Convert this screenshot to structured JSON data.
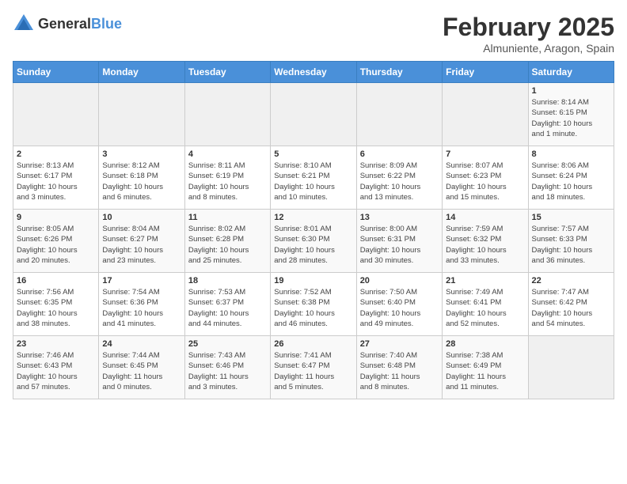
{
  "header": {
    "logo_general": "General",
    "logo_blue": "Blue",
    "title": "February 2025",
    "subtitle": "Almuniente, Aragon, Spain"
  },
  "days_of_week": [
    "Sunday",
    "Monday",
    "Tuesday",
    "Wednesday",
    "Thursday",
    "Friday",
    "Saturday"
  ],
  "weeks": [
    [
      {
        "day": "",
        "info": ""
      },
      {
        "day": "",
        "info": ""
      },
      {
        "day": "",
        "info": ""
      },
      {
        "day": "",
        "info": ""
      },
      {
        "day": "",
        "info": ""
      },
      {
        "day": "",
        "info": ""
      },
      {
        "day": "1",
        "info": "Sunrise: 8:14 AM\nSunset: 6:15 PM\nDaylight: 10 hours\nand 1 minute."
      }
    ],
    [
      {
        "day": "2",
        "info": "Sunrise: 8:13 AM\nSunset: 6:17 PM\nDaylight: 10 hours\nand 3 minutes."
      },
      {
        "day": "3",
        "info": "Sunrise: 8:12 AM\nSunset: 6:18 PM\nDaylight: 10 hours\nand 6 minutes."
      },
      {
        "day": "4",
        "info": "Sunrise: 8:11 AM\nSunset: 6:19 PM\nDaylight: 10 hours\nand 8 minutes."
      },
      {
        "day": "5",
        "info": "Sunrise: 8:10 AM\nSunset: 6:21 PM\nDaylight: 10 hours\nand 10 minutes."
      },
      {
        "day": "6",
        "info": "Sunrise: 8:09 AM\nSunset: 6:22 PM\nDaylight: 10 hours\nand 13 minutes."
      },
      {
        "day": "7",
        "info": "Sunrise: 8:07 AM\nSunset: 6:23 PM\nDaylight: 10 hours\nand 15 minutes."
      },
      {
        "day": "8",
        "info": "Sunrise: 8:06 AM\nSunset: 6:24 PM\nDaylight: 10 hours\nand 18 minutes."
      }
    ],
    [
      {
        "day": "9",
        "info": "Sunrise: 8:05 AM\nSunset: 6:26 PM\nDaylight: 10 hours\nand 20 minutes."
      },
      {
        "day": "10",
        "info": "Sunrise: 8:04 AM\nSunset: 6:27 PM\nDaylight: 10 hours\nand 23 minutes."
      },
      {
        "day": "11",
        "info": "Sunrise: 8:02 AM\nSunset: 6:28 PM\nDaylight: 10 hours\nand 25 minutes."
      },
      {
        "day": "12",
        "info": "Sunrise: 8:01 AM\nSunset: 6:30 PM\nDaylight: 10 hours\nand 28 minutes."
      },
      {
        "day": "13",
        "info": "Sunrise: 8:00 AM\nSunset: 6:31 PM\nDaylight: 10 hours\nand 30 minutes."
      },
      {
        "day": "14",
        "info": "Sunrise: 7:59 AM\nSunset: 6:32 PM\nDaylight: 10 hours\nand 33 minutes."
      },
      {
        "day": "15",
        "info": "Sunrise: 7:57 AM\nSunset: 6:33 PM\nDaylight: 10 hours\nand 36 minutes."
      }
    ],
    [
      {
        "day": "16",
        "info": "Sunrise: 7:56 AM\nSunset: 6:35 PM\nDaylight: 10 hours\nand 38 minutes."
      },
      {
        "day": "17",
        "info": "Sunrise: 7:54 AM\nSunset: 6:36 PM\nDaylight: 10 hours\nand 41 minutes."
      },
      {
        "day": "18",
        "info": "Sunrise: 7:53 AM\nSunset: 6:37 PM\nDaylight: 10 hours\nand 44 minutes."
      },
      {
        "day": "19",
        "info": "Sunrise: 7:52 AM\nSunset: 6:38 PM\nDaylight: 10 hours\nand 46 minutes."
      },
      {
        "day": "20",
        "info": "Sunrise: 7:50 AM\nSunset: 6:40 PM\nDaylight: 10 hours\nand 49 minutes."
      },
      {
        "day": "21",
        "info": "Sunrise: 7:49 AM\nSunset: 6:41 PM\nDaylight: 10 hours\nand 52 minutes."
      },
      {
        "day": "22",
        "info": "Sunrise: 7:47 AM\nSunset: 6:42 PM\nDaylight: 10 hours\nand 54 minutes."
      }
    ],
    [
      {
        "day": "23",
        "info": "Sunrise: 7:46 AM\nSunset: 6:43 PM\nDaylight: 10 hours\nand 57 minutes."
      },
      {
        "day": "24",
        "info": "Sunrise: 7:44 AM\nSunset: 6:45 PM\nDaylight: 11 hours\nand 0 minutes."
      },
      {
        "day": "25",
        "info": "Sunrise: 7:43 AM\nSunset: 6:46 PM\nDaylight: 11 hours\nand 3 minutes."
      },
      {
        "day": "26",
        "info": "Sunrise: 7:41 AM\nSunset: 6:47 PM\nDaylight: 11 hours\nand 5 minutes."
      },
      {
        "day": "27",
        "info": "Sunrise: 7:40 AM\nSunset: 6:48 PM\nDaylight: 11 hours\nand 8 minutes."
      },
      {
        "day": "28",
        "info": "Sunrise: 7:38 AM\nSunset: 6:49 PM\nDaylight: 11 hours\nand 11 minutes."
      },
      {
        "day": "",
        "info": ""
      }
    ]
  ]
}
